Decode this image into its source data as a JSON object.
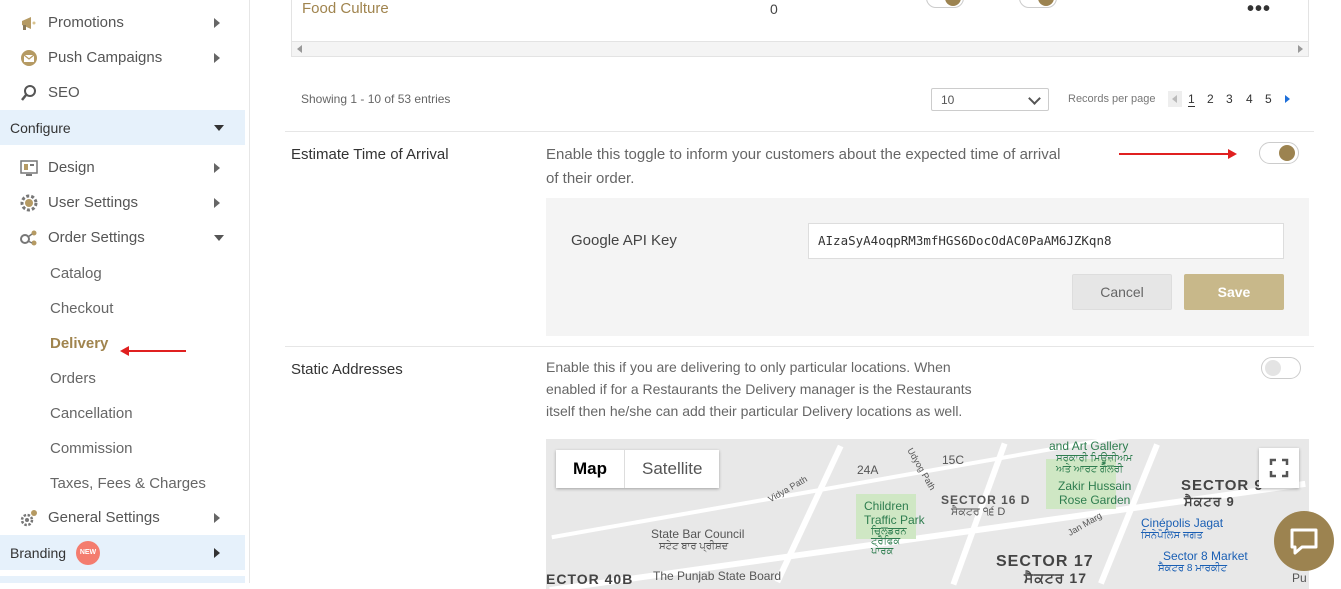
{
  "sidebar": {
    "items": [
      {
        "label": "Promotions",
        "icon": "megaphone-icon"
      },
      {
        "label": "Push Campaigns",
        "icon": "envelope-icon"
      },
      {
        "label": "SEO",
        "icon": "magnifier-icon"
      }
    ],
    "configure_label": "Configure",
    "config_items": [
      {
        "label": "Design",
        "icon": "design-icon"
      },
      {
        "label": "User Settings",
        "icon": "user-gear-icon"
      },
      {
        "label": "Order Settings",
        "icon": "order-settings-icon"
      }
    ],
    "sub_items": [
      "Catalog",
      "Checkout",
      "Delivery",
      "Orders",
      "Cancellation",
      "Commission",
      "Taxes, Fees & Charges"
    ],
    "general_label": "General Settings",
    "branding_label": "Branding",
    "new_badge": "NEW"
  },
  "table": {
    "row_name": "Food Culture",
    "row_count": "0",
    "menu_glyph": "•••"
  },
  "pagination": {
    "showing": "Showing 1 - 10 of 53 entries",
    "per_page_value": "10",
    "records_label": "Records per page",
    "pages": [
      "1",
      "2",
      "3",
      "4",
      "5"
    ]
  },
  "eta": {
    "title": "Estimate Time of Arrival",
    "description": "Enable this toggle to inform your customers about the expected time of arrival of their order.",
    "enabled": true,
    "api_label": "Google API Key",
    "api_value": "AIzaSyA4oqpRM3mfHGS6DocOdAC0PaAM6JZKqn8",
    "cancel_label": "Cancel",
    "save_label": "Save"
  },
  "static_addresses": {
    "title": "Static Addresses",
    "description": "Enable this if you are delivering to only particular locations. When enabled if for a Restaurants the Delivery manager is the Restaurants itself then he/she can add their particular Delivery locations as well.",
    "enabled": false
  },
  "map": {
    "tab_map": "Map",
    "tab_satellite": "Satellite",
    "labels": {
      "gallery": "and Art Gallery",
      "gallery_pa": "ਸਰਕਾਰੀ ਮਿਊਜ਼ੀਅਮ\nਅਤੇ ਆਰਟ ਗੈਲਰੀ",
      "s24a": "24A",
      "s15c": "15C",
      "udyog": "Udyog Path",
      "vidya": "Vidya Path",
      "children": "Children\nTraffic Park",
      "children_pa": "ਚਿਲਡਰਨ\nਟ੍ਰੈਫਿਕ\nਪਾਰਕ",
      "sector16d": "SECTOR 16 D",
      "sector16d_pa": "ਸੈਕਟਰ ੧੬ D",
      "zakir": "Zakir Hussain\nRose Garden",
      "sector9": "SECTOR 9",
      "sector9_pa": "ਸੈਕਟਰ 9",
      "janmarg": "Jan Marg",
      "cinepolis": "Cinépolis Jagat",
      "cinepolis_pa": "ਸਿਨੇਪੋਲਿਸ ਜਗਤ",
      "barcouncil": "State Bar Council",
      "barcouncil_pa": "ਸਟੇਟ ਬਾਰ ਪ੍ਰੀਸ਼ਦ",
      "sector17": "SECTOR 17",
      "sector17_pa": "ਸੈਕਟਰ 17",
      "sector8": "Sector 8 Market",
      "sector8_pa": "ਸੈਕਟਰ 8 ਮਾਰਕੀਟ",
      "punjab": "The Punjab State Board",
      "sector40": "ECTOR 40B",
      "pu": "Pu"
    }
  },
  "colors": {
    "accent": "#9c8350",
    "accent_text": "#a0844e",
    "save_btn": "#c8b88a",
    "section_bg": "#e6f1fb",
    "arrow": "#e02020"
  }
}
